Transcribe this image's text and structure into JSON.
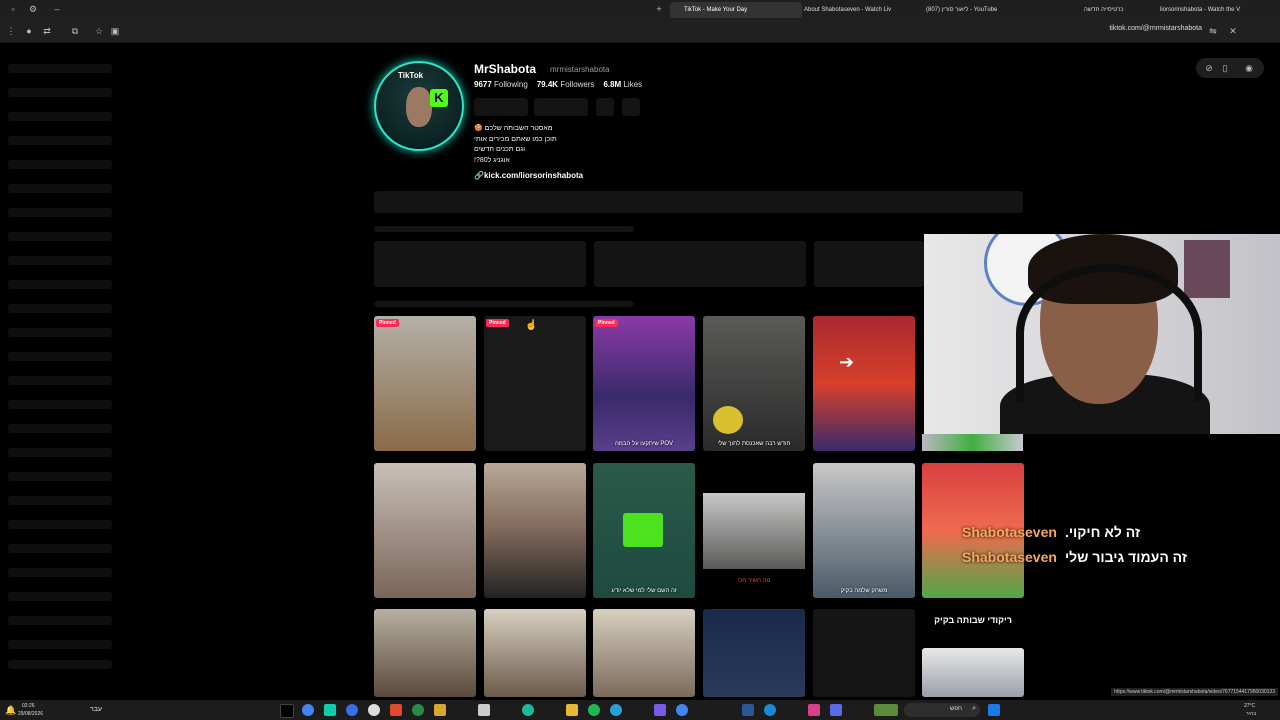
{
  "tabs": [
    {
      "label": "TikTok - Make Your Day",
      "active": true
    },
    {
      "label": "About Shabotaseven - Watch Liv",
      "active": false
    },
    {
      "label": "(807) ליאור סורין - YouTube",
      "active": false
    },
    {
      "label": "כרטיסייה חדשה",
      "active": false
    },
    {
      "label": "liorsorinshabota - Watch the V",
      "active": false
    }
  ],
  "address_bar": {
    "url": "tiktok.com/@mrmistarshabota"
  },
  "profile": {
    "display_name": "MrShabota",
    "username": "mrmistarshabota",
    "following_count": "9677",
    "following_label": "Following",
    "followers_count": "79.4K",
    "followers_label": "Followers",
    "likes_count": "6.8M",
    "likes_label": "Likes",
    "bio_lines": [
      "מאסטר השבותה שלכם 🍪",
      "תוכן כמו שאתם מכירים אותי",
      "וגם תכנים חדשים",
      "אוגניג ל80?!"
    ],
    "link": "kick.com/liorsorinshabota"
  },
  "avatar": {
    "tiktok_text": "TikTok",
    "kick_text": "K"
  },
  "videos": [
    {
      "pinned": true,
      "caption": "",
      "bg": "#8a6a48"
    },
    {
      "pinned": true,
      "caption": "",
      "bg": "#1e1e1e"
    },
    {
      "pinned": true,
      "caption": "POV שיתקעו על הבמה",
      "bg": "#5a3f8a"
    },
    {
      "pinned": false,
      "caption": "חודש רבה שאכנסת לתוך שלי",
      "bg": "#3a3a36"
    },
    {
      "pinned": false,
      "caption": "",
      "bg": "#8a3040"
    },
    {
      "pinned": false,
      "caption": "",
      "bg": "#7a6458"
    },
    {
      "pinned": false,
      "caption": "",
      "bg": "#80685a"
    },
    {
      "pinned": false,
      "caption": "זה השם שלי למי שלא יודע",
      "bg": "#1f4a40"
    },
    {
      "pinned": false,
      "caption": "מה חשיר חכי",
      "bg": "#5a5a58"
    },
    {
      "pinned": false,
      "caption": "משחק שלמה בקיק",
      "bg": "#4a5a68"
    },
    {
      "pinned": false,
      "caption": "",
      "bg": "#b83c3c"
    },
    {
      "pinned": false,
      "caption": "",
      "bg": "#5a4a3c"
    },
    {
      "pinned": false,
      "caption": "",
      "bg": "#6a5a4a"
    },
    {
      "pinned": false,
      "caption": "",
      "bg": "#7a6a5a"
    },
    {
      "pinned": false,
      "caption": "",
      "bg": "#2a3a5a"
    }
  ],
  "pinned_label": "Pinned",
  "section_label": "ריקודי שבותה בקיק",
  "overlay": [
    {
      "name": "Shabotaseven",
      "text": "זה לא חיקוי."
    },
    {
      "name": "Shabotaseven",
      "text": "זה העמוד גיבור שלי"
    }
  ],
  "taskbar": {
    "time": "02:26",
    "date": "29/08/2026",
    "lang": "עבר",
    "weather": "27°C",
    "weather_desc": "בהיר",
    "search_text": "חפש"
  },
  "status_url": "https://www.tiktok.com/@mrmistarshabota/video/7677154417950030133"
}
